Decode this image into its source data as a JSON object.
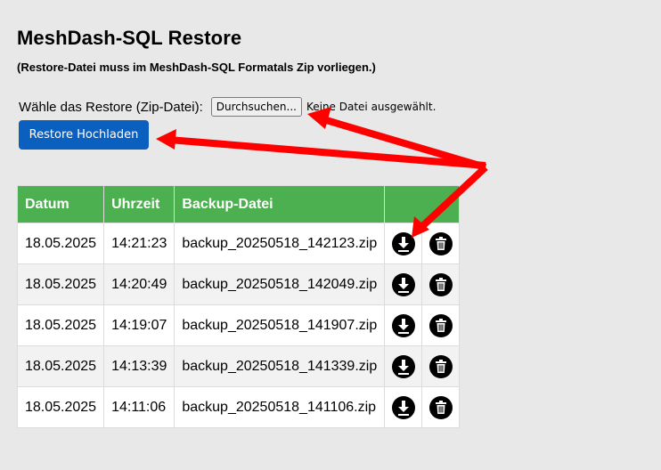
{
  "header": {
    "title": "MeshDash-SQL Restore",
    "subtitle": "(Restore-Datei muss im MeshDash-SQL Formatals Zip vorliegen.)"
  },
  "upload": {
    "label": "Wähle das Restore (Zip-Datei):",
    "browse_label": "Durchsuchen...",
    "no_file_text": "Keine Datei ausgewählt.",
    "submit_label": "Restore Hochladen"
  },
  "table": {
    "headers": [
      "Datum",
      "Uhrzeit",
      "Backup-Datei",
      ""
    ],
    "rows": [
      {
        "date": "18.05.2025",
        "time": "14:21:23",
        "file": "backup_20250518_142123.zip"
      },
      {
        "date": "18.05.2025",
        "time": "14:20:49",
        "file": "backup_20250518_142049.zip"
      },
      {
        "date": "18.05.2025",
        "time": "14:19:07",
        "file": "backup_20250518_141907.zip"
      },
      {
        "date": "18.05.2025",
        "time": "14:13:39",
        "file": "backup_20250518_141339.zip"
      },
      {
        "date": "18.05.2025",
        "time": "14:11:06",
        "file": "backup_20250518_141106.zip"
      }
    ]
  },
  "icons": {
    "download": "download-icon",
    "delete": "trash-icon"
  },
  "colors": {
    "header_green": "#4caf50",
    "button_blue": "#0b5fbf",
    "annotation_red": "#ff0000"
  }
}
